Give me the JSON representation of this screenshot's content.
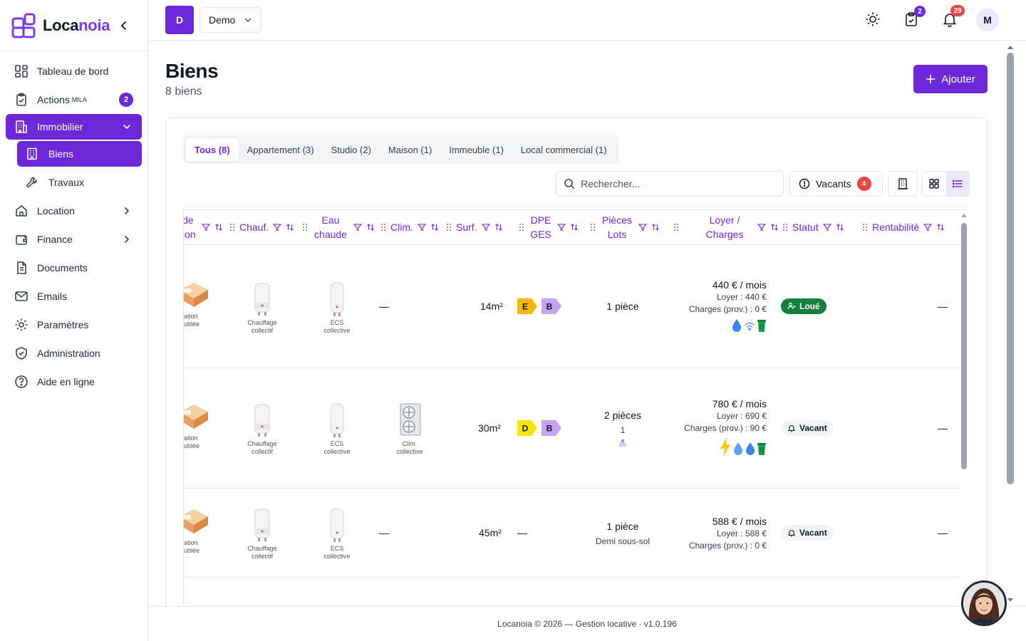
{
  "app": {
    "logo_first": "Loca",
    "logo_second": "noia"
  },
  "sidebar": {
    "items": [
      {
        "label": "Tableau de bord"
      },
      {
        "label": "Actions",
        "sup": "MILA",
        "badge": "2"
      },
      {
        "label": "Immobilier"
      },
      {
        "label": "Biens"
      },
      {
        "label": "Travaux"
      },
      {
        "label": "Location"
      },
      {
        "label": "Finance"
      },
      {
        "label": "Documents"
      },
      {
        "label": "Emails"
      },
      {
        "label": "Paramètres"
      },
      {
        "label": "Administration"
      },
      {
        "label": "Aide en ligne"
      }
    ]
  },
  "topbar": {
    "org_initial": "D",
    "org_name": "Demo",
    "tasks_badge": "2",
    "notifications_badge": "29",
    "user_initial": "M"
  },
  "page": {
    "title": "Biens",
    "subtitle": "8 biens",
    "add_label": "Ajouter"
  },
  "tabs": [
    {
      "label": "Tous (8)",
      "active": true
    },
    {
      "label": "Appartement (3)"
    },
    {
      "label": "Studio (2)"
    },
    {
      "label": "Maison (1)"
    },
    {
      "label": "Immeuble (1)"
    },
    {
      "label": "Local commercial (1)"
    }
  ],
  "toolbar": {
    "search_placeholder": "Rechercher...",
    "vacants_label": "Vacants",
    "vacants_count": "4"
  },
  "table": {
    "columns": [
      {
        "line1": "de",
        "line2": "ion"
      },
      {
        "line1": "Chauf.",
        "line2": ""
      },
      {
        "line1": "Eau",
        "line2": "chaude"
      },
      {
        "line1": "Clim.",
        "line2": ""
      },
      {
        "line1": "Surf.",
        "line2": ""
      },
      {
        "line1": "DPE",
        "line2": "GES"
      },
      {
        "line1": "Pièces",
        "line2": "Lots"
      },
      {
        "line1": "Loyer /",
        "line2": "Charges"
      },
      {
        "line1": "Statut",
        "line2": ""
      },
      {
        "line1": "Rentabilité",
        "line2": ""
      }
    ],
    "rows": [
      {
        "type_caption1": "ation",
        "type_caption2": "ublée",
        "chauf_caption1": "Chauffage",
        "chauf_caption2": "collectif",
        "eau_caption1": "ECS",
        "eau_caption2": "collective",
        "clim": "—",
        "surface": "14m²",
        "dpe": "E",
        "ges": "B",
        "pieces": "1 pièce",
        "rent_main": "440 € / mois",
        "rent_loyer": "Loyer : 440 €",
        "rent_charges": "Charges (prov.) : 0 €",
        "status": "Loué",
        "rentabilite": "—"
      },
      {
        "type_caption1": "ation",
        "type_caption2": "ublée",
        "chauf_caption1": "Chauffage",
        "chauf_caption2": "collectif",
        "eau_caption1": "ECS",
        "eau_caption2": "collective",
        "clim_caption1": "Clim.",
        "clim_caption2": "collective",
        "surface": "30m²",
        "dpe": "D",
        "ges": "B",
        "pieces": "2 pièces",
        "lots": "1",
        "rent_main": "780 € / mois",
        "rent_loyer": "Loyer : 690 €",
        "rent_charges": "Charges (prov.) : 90 €",
        "status": "Vacant",
        "rentabilite": "—"
      },
      {
        "type_caption1": "ation",
        "type_caption2": "ublée",
        "chauf_caption1": "Chauffage",
        "chauf_caption2": "collectif",
        "eau_caption1": "ECS",
        "eau_caption2": "collective",
        "clim": "—",
        "surface": "45m²",
        "dpe_empty": "—",
        "pieces": "1 pièce",
        "lots_text": "Demi sous-sol",
        "rent_main": "588 € / mois",
        "rent_loyer": "Loyer : 588 €",
        "rent_charges": "Charges (prov.) : 0 €",
        "status": "Vacant",
        "rentabilite": "—"
      }
    ]
  },
  "colors": {
    "accent": "#6d28d9",
    "dpe_e": "#f5b800",
    "dpe_d": "#f6e600",
    "ges_b": "#c4a3f0",
    "status_loue": "#15803d",
    "badge_red": "#ef4444"
  },
  "footer": {
    "text": "Locanoia © 2026 — Gestion locative · v1.0.196"
  }
}
